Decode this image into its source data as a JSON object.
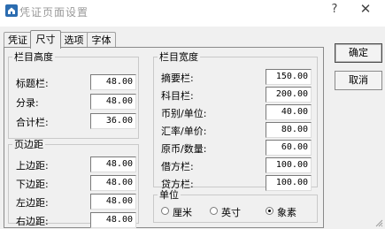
{
  "window": {
    "title": "凭证页面设置",
    "help_glyph": "?",
    "close_glyph": "✕",
    "app_icon": "house-icon"
  },
  "tabs": [
    "凭证",
    "尺寸",
    "选项",
    "字体"
  ],
  "active_tab": "尺寸",
  "column_height": {
    "title": "栏目高度",
    "fields": [
      {
        "label": "标题栏:",
        "value": "48.00"
      },
      {
        "label": "分录:",
        "value": "48.00"
      },
      {
        "label": "合计栏:",
        "value": "36.00"
      }
    ]
  },
  "margins": {
    "title": "页边距",
    "fields": [
      {
        "label": "上边距:",
        "value": "48.00"
      },
      {
        "label": "下边距:",
        "value": "48.00"
      },
      {
        "label": "左边距:",
        "value": "48.00"
      },
      {
        "label": "右边距:",
        "value": "48.00"
      }
    ]
  },
  "column_width": {
    "title": "栏目宽度",
    "fields": [
      {
        "label": "摘要栏:",
        "value": "150.00"
      },
      {
        "label": "科目栏:",
        "value": "200.00"
      },
      {
        "label": "币别/单位:",
        "value": "40.00"
      },
      {
        "label": "汇率/单价:",
        "value": "80.00"
      },
      {
        "label": "原币/数量:",
        "value": "60.00"
      },
      {
        "label": "借方栏:",
        "value": "100.00"
      },
      {
        "label": "贷方栏:",
        "value": "100.00"
      }
    ]
  },
  "units": {
    "title": "单位",
    "options": [
      "厘米",
      "英寸",
      "象素"
    ],
    "selected": "象素"
  },
  "buttons": {
    "ok": "确定",
    "cancel": "取消"
  }
}
